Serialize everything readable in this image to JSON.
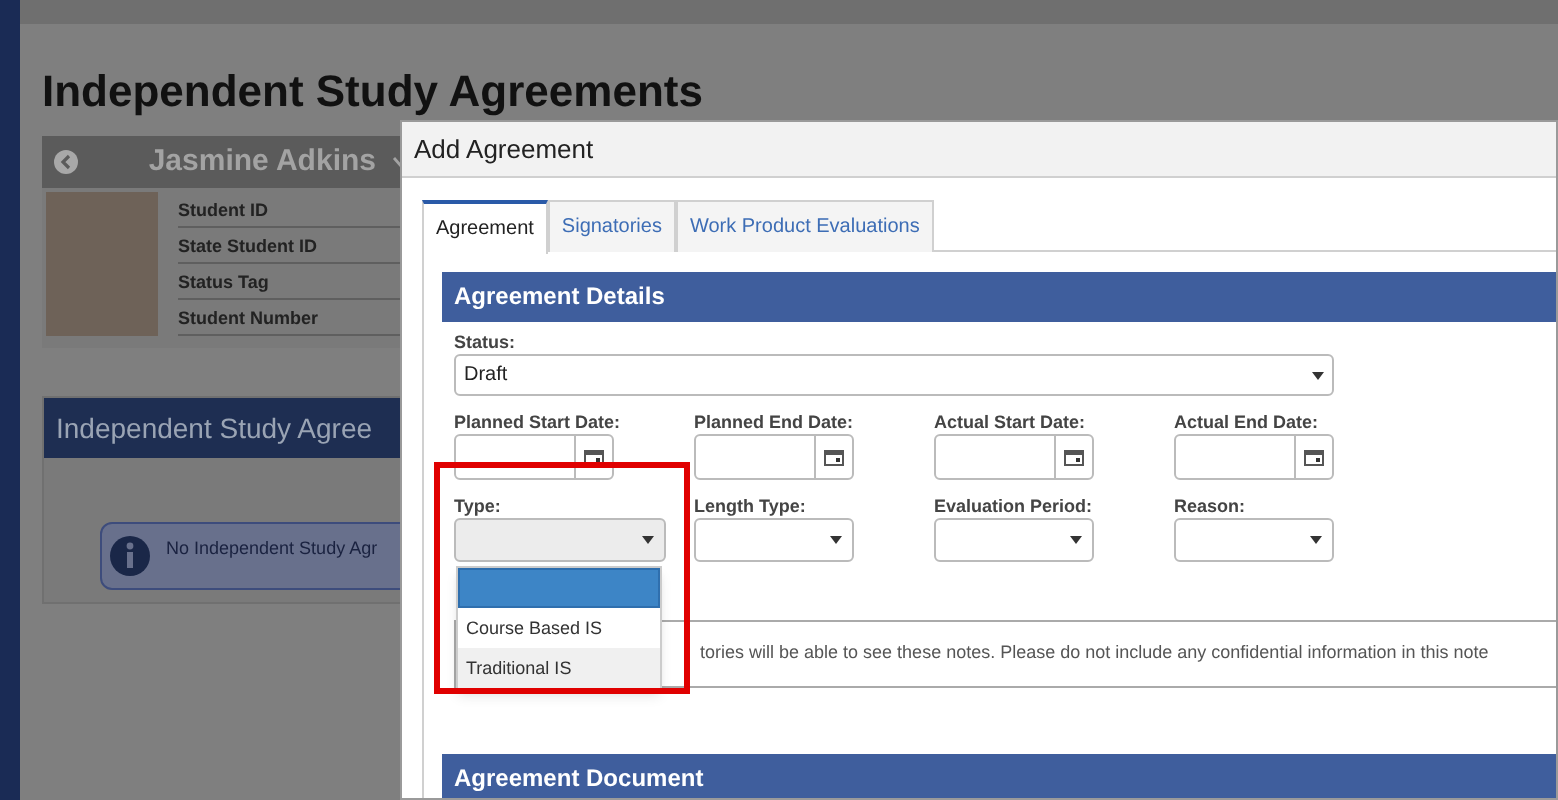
{
  "page": {
    "title": "Independent Study Agreements"
  },
  "student": {
    "name": "Jasmine Adkins",
    "fields": [
      "Student ID",
      "State Student ID",
      "Status Tag",
      "Student Number"
    ]
  },
  "panel": {
    "title": "Independent Study Agree",
    "message": "No Independent Study Agr"
  },
  "dialog": {
    "title": "Add Agreement",
    "tabs": [
      {
        "label": "Agreement",
        "selected": true
      },
      {
        "label": "Signatories",
        "selected": false
      },
      {
        "label": "Work Product Evaluations",
        "selected": false
      }
    ],
    "details": {
      "title": "Agreement Details",
      "status": {
        "label": "Status:",
        "value": "Draft"
      },
      "dates": [
        {
          "label": "Planned Start Date:"
        },
        {
          "label": "Planned End Date:"
        },
        {
          "label": "Actual Start Date:"
        },
        {
          "label": "Actual End Date:"
        }
      ],
      "selects": [
        {
          "label": "Type:",
          "expanded": true,
          "highlighted": true,
          "options": [
            {
              "kind": "blank",
              "selected": true,
              "hovered": false
            },
            {
              "kind": "text",
              "label": "Course Based IS",
              "selected": false,
              "hovered": false
            },
            {
              "kind": "text",
              "label": "Traditional IS",
              "selected": false,
              "hovered": true
            }
          ]
        },
        {
          "label": "Length Type:",
          "expanded": false,
          "highlighted": false
        },
        {
          "label": "Evaluation Period:",
          "expanded": false,
          "highlighted": false
        },
        {
          "label": "Reason:",
          "expanded": false,
          "highlighted": false
        }
      ],
      "notes": "tories will be able to see these notes. Please do not include any confidential information in this note"
    },
    "document": {
      "title": "Agreement Document"
    }
  }
}
